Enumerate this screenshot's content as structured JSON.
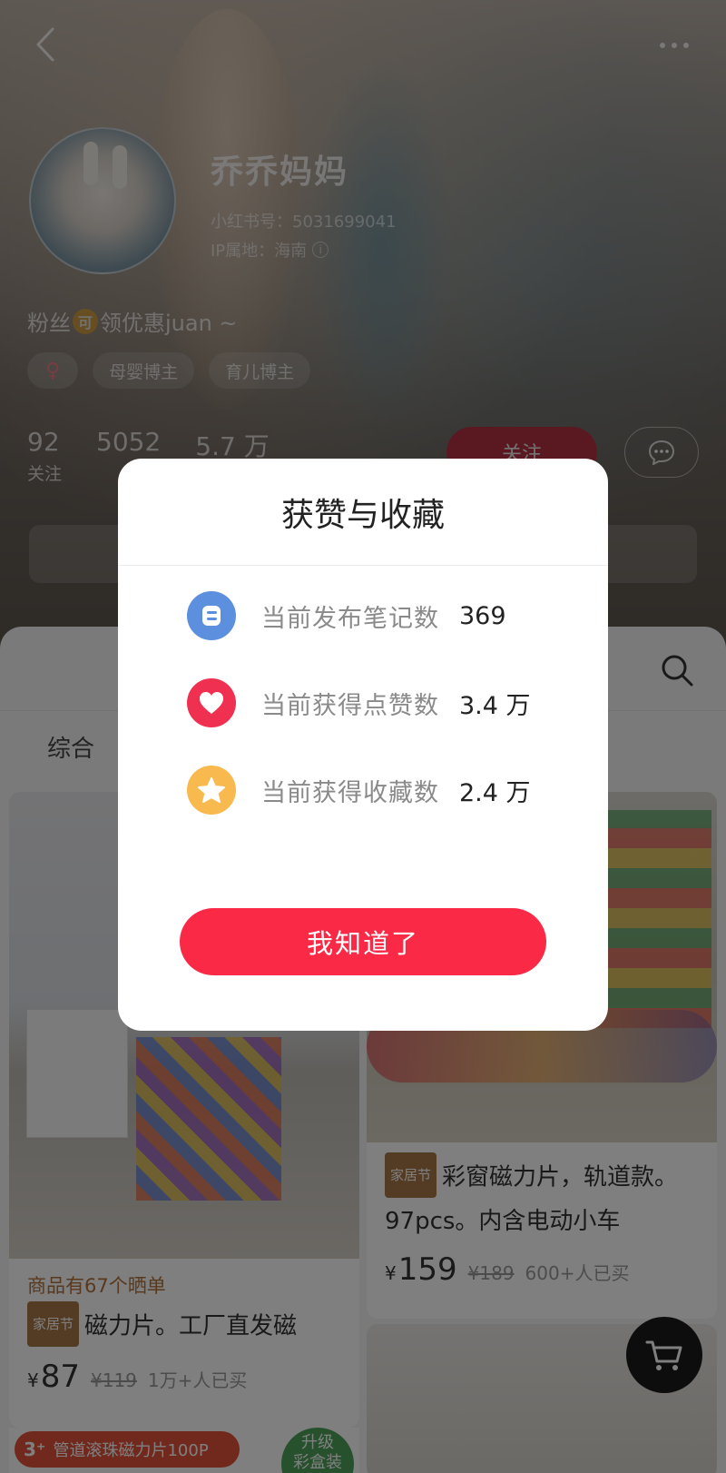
{
  "profile": {
    "nickname": "乔乔妈妈",
    "red_id": "小红书号：5031699041",
    "ip_location": "IP属地：海南",
    "bio_prefix": "粉丝",
    "bio_coin": "可",
    "bio_suffix": "领优惠juan ~",
    "tags": [
      "♀",
      "母婴博主",
      "育儿博主"
    ],
    "stats": [
      {
        "value": "92",
        "label": "关注"
      },
      {
        "value": "5052",
        "label": ""
      },
      {
        "value": "5.7 万",
        "label": ""
      }
    ],
    "follow_label": "关注"
  },
  "tabs": {
    "comprehensive": "综合"
  },
  "products": [
    {
      "review_count": "商品有67个晒单",
      "promo": "家居节",
      "title": "磁力片。工厂直发磁",
      "currency": "¥",
      "price": "87",
      "old_price": "¥119",
      "sold": "1万+人已买"
    },
    {
      "promo": "家居节",
      "title": "彩窗磁力片，轨道款。97pcs。内含电动小车",
      "currency": "¥",
      "price": "159",
      "old_price": "¥189",
      "sold": "600+人已买"
    }
  ],
  "bottom_ad": {
    "num": "3⁺",
    "text": "管道滚珠磁力片100P",
    "upgrade": "升级\n彩盒装"
  },
  "modal": {
    "title": "获赞与收藏",
    "rows": [
      {
        "label": "当前发布笔记数",
        "value": "369",
        "icon": "note-icon"
      },
      {
        "label": "当前获得点赞数",
        "value": "3.4 万",
        "icon": "heart-icon"
      },
      {
        "label": "当前获得收藏数",
        "value": "2.4 万",
        "icon": "star-icon"
      }
    ],
    "button": "我知道了"
  },
  "colors": {
    "accent": "#fa2a47",
    "note_blue": "#5d8fdf",
    "like_red": "#f03050",
    "collect_yellow": "#f8b94e"
  }
}
